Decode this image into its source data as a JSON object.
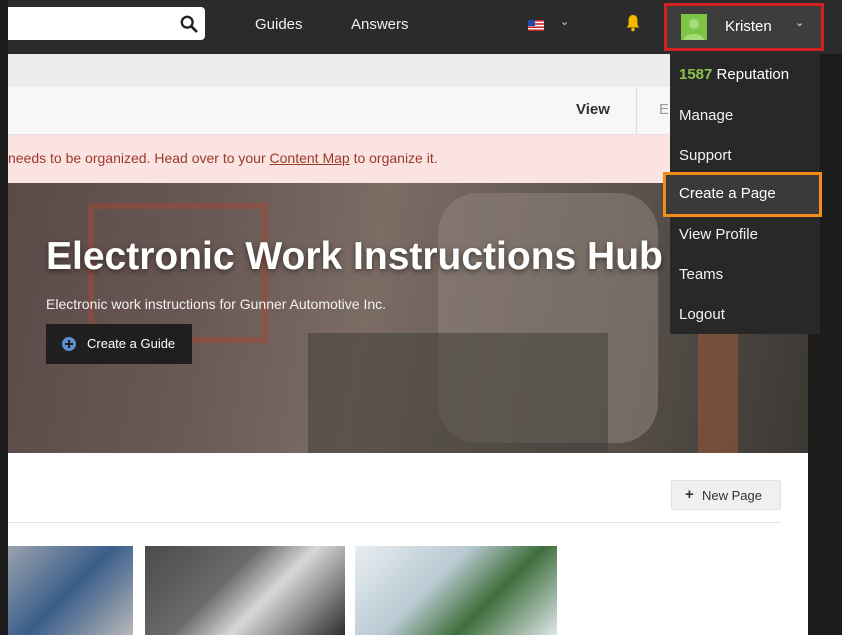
{
  "topbar": {
    "search_value": "",
    "nav": [
      "Guides",
      "Answers"
    ],
    "user_name": "Kristen"
  },
  "tabs": {
    "view": "View",
    "edit": "E"
  },
  "alert": {
    "text_before": "needs to be organized. Head over to your ",
    "link": "Content Map",
    "text_after": " to organize it."
  },
  "hero": {
    "title": "Electronic Work Instructions Hub",
    "subtitle": "Electronic work instructions for Gunner Automotive Inc.",
    "button": "Create a Guide"
  },
  "section": {
    "new_page": "New Page"
  },
  "dropdown": {
    "reputation_value": "1587",
    "reputation_label": "Reputation",
    "items": [
      "Manage",
      "Support",
      "Create a Page",
      "View Profile",
      "Teams",
      "Logout"
    ]
  },
  "colors": {
    "highlight_user": "#d21f1f",
    "highlight_item": "#f28c1b",
    "reputation": "#8bc34a"
  }
}
